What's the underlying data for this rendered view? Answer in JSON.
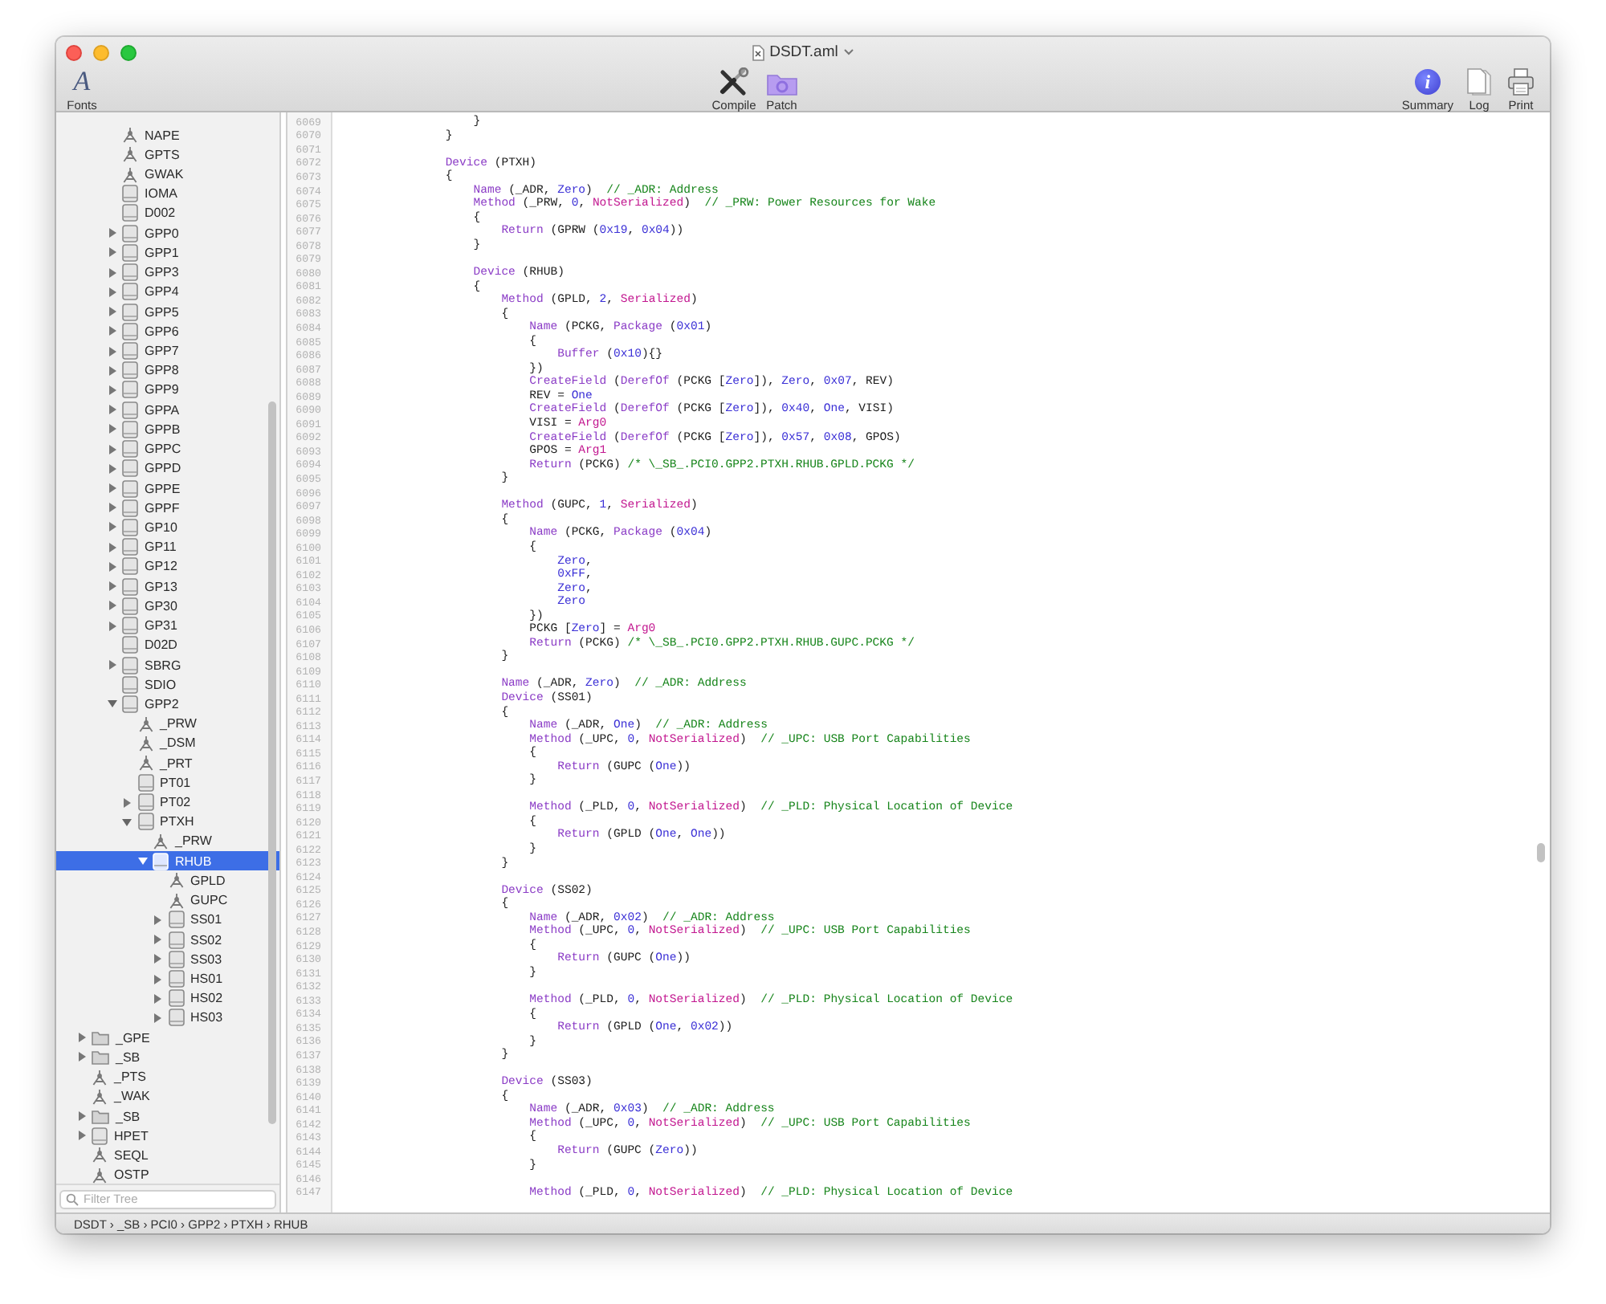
{
  "window": {
    "title": "DSDT.aml"
  },
  "toolbar": {
    "left": [
      {
        "kind": "fonts",
        "glyph": "A",
        "label": "Fonts"
      }
    ],
    "center": [
      {
        "kind": "compile",
        "label": "Compile"
      },
      {
        "kind": "patch",
        "label": "Patch"
      }
    ],
    "right": [
      {
        "kind": "summary",
        "glyph": "i",
        "label": "Summary"
      },
      {
        "kind": "log",
        "label": "Log"
      },
      {
        "kind": "print",
        "label": "Print"
      }
    ]
  },
  "sidebar": {
    "tree": [
      {
        "children": [
          {
            "children": [
              {
                "label": "NAPE",
                "kind": "method",
                "selected": false
              },
              {
                "label": "GPTS",
                "kind": "method",
                "selected": false
              },
              {
                "label": "GWAK",
                "kind": "method",
                "selected": false
              },
              {
                "label": "IOMA",
                "kind": "device",
                "selected": false
              },
              {
                "label": "D002",
                "kind": "device",
                "selected": false
              },
              {
                "label": "GPP0",
                "kind": "device",
                "expanded": false,
                "selected": false
              },
              {
                "label": "GPP1",
                "kind": "device",
                "expanded": false,
                "selected": false
              },
              {
                "label": "GPP3",
                "kind": "device",
                "expanded": false,
                "selected": false
              },
              {
                "label": "GPP4",
                "kind": "device",
                "expanded": false,
                "selected": false
              },
              {
                "label": "GPP5",
                "kind": "device",
                "expanded": false,
                "selected": false
              },
              {
                "label": "GPP6",
                "kind": "device",
                "expanded": false,
                "selected": false
              },
              {
                "label": "GPP7",
                "kind": "device",
                "expanded": false,
                "selected": false
              },
              {
                "label": "GPP8",
                "kind": "device",
                "expanded": false,
                "selected": false
              },
              {
                "label": "GPP9",
                "kind": "device",
                "expanded": false,
                "selected": false
              },
              {
                "label": "GPPA",
                "kind": "device",
                "expanded": false,
                "selected": false
              },
              {
                "label": "GPPB",
                "kind": "device",
                "expanded": false,
                "selected": false
              },
              {
                "label": "GPPC",
                "kind": "device",
                "expanded": false,
                "selected": false
              },
              {
                "label": "GPPD",
                "kind": "device",
                "expanded": false,
                "selected": false
              },
              {
                "label": "GPPE",
                "kind": "device",
                "expanded": false,
                "selected": false
              },
              {
                "label": "GPPF",
                "kind": "device",
                "expanded": false,
                "selected": false
              },
              {
                "label": "GP10",
                "kind": "device",
                "expanded": false,
                "selected": false
              },
              {
                "label": "GP11",
                "kind": "device",
                "expanded": false,
                "selected": false
              },
              {
                "label": "GP12",
                "kind": "device",
                "expanded": false,
                "selected": false
              },
              {
                "label": "GP13",
                "kind": "device",
                "expanded": false,
                "selected": false
              },
              {
                "label": "GP30",
                "kind": "device",
                "expanded": false,
                "selected": false
              },
              {
                "label": "GP31",
                "kind": "device",
                "expanded": false,
                "selected": false
              },
              {
                "label": "D02D",
                "kind": "device",
                "selected": false
              },
              {
                "label": "SBRG",
                "kind": "device",
                "expanded": false,
                "selected": false
              },
              {
                "label": "SDIO",
                "kind": "device",
                "selected": false
              },
              {
                "label": "GPP2",
                "kind": "device",
                "expanded": true,
                "selected": false,
                "children": [
                  {
                    "label": "_PRW",
                    "kind": "method",
                    "selected": false
                  },
                  {
                    "label": "_DSM",
                    "kind": "method",
                    "selected": false
                  },
                  {
                    "label": "_PRT",
                    "kind": "method",
                    "selected": false
                  },
                  {
                    "label": "PT01",
                    "kind": "device",
                    "selected": false
                  },
                  {
                    "label": "PT02",
                    "kind": "device",
                    "expanded": false,
                    "selected": false
                  },
                  {
                    "label": "PTXH",
                    "kind": "device",
                    "expanded": true,
                    "selected": false,
                    "children": [
                      {
                        "label": "_PRW",
                        "kind": "method",
                        "selected": false
                      },
                      {
                        "label": "RHUB",
                        "kind": "device",
                        "expanded": true,
                        "selected": true,
                        "children": [
                          {
                            "label": "GPLD",
                            "kind": "method",
                            "selected": false
                          },
                          {
                            "label": "GUPC",
                            "kind": "method",
                            "selected": false
                          },
                          {
                            "label": "SS01",
                            "kind": "device",
                            "expanded": false,
                            "selected": false
                          },
                          {
                            "label": "SS02",
                            "kind": "device",
                            "expanded": false,
                            "selected": false
                          },
                          {
                            "label": "SS03",
                            "kind": "device",
                            "expanded": false,
                            "selected": false
                          },
                          {
                            "label": "HS01",
                            "kind": "device",
                            "expanded": false,
                            "selected": false
                          },
                          {
                            "label": "HS02",
                            "kind": "device",
                            "expanded": false,
                            "selected": false
                          },
                          {
                            "label": "HS03",
                            "kind": "device",
                            "expanded": false,
                            "selected": false
                          }
                        ]
                      }
                    ]
                  }
                ]
              }
            ]
          }
        ]
      },
      {
        "label": "_GPE",
        "kind": "scope",
        "expanded": false,
        "selected": false
      },
      {
        "label": "_SB",
        "kind": "scope",
        "expanded": false,
        "selected": false
      },
      {
        "label": "_PTS",
        "kind": "method",
        "selected": false
      },
      {
        "label": "_WAK",
        "kind": "method",
        "selected": false
      },
      {
        "label": "_SB",
        "kind": "scope",
        "expanded": false,
        "selected": false
      },
      {
        "label": "HPET",
        "kind": "device",
        "expanded": false,
        "selected": false
      },
      {
        "label": "SEQL",
        "kind": "method",
        "selected": false
      },
      {
        "label": "OSTP",
        "kind": "method",
        "selected": false
      }
    ],
    "filter": {
      "placeholder": "Filter Tree"
    }
  },
  "code": {
    "lines": [
      {
        "number": "6069",
        "tokens": [
          {
            "kind": "plain",
            "text": "                }"
          }
        ]
      },
      {
        "number": "6070",
        "tokens": [
          {
            "kind": "plain",
            "text": "            }"
          }
        ]
      },
      {
        "number": "6071"
      },
      {
        "number": "6072",
        "tokens": [
          {
            "kind": "keyword",
            "text": "            Device"
          },
          {
            "kind": "plain",
            "text": " (PTXH)"
          }
        ]
      },
      {
        "number": "6073",
        "tokens": [
          {
            "kind": "plain",
            "text": "            {"
          }
        ]
      },
      {
        "number": "6074",
        "tokens": [
          {
            "kind": "keyword",
            "text": "                Name"
          },
          {
            "kind": "plain",
            "text": " (_ADR, "
          },
          {
            "kind": "number",
            "text": "Zero"
          },
          {
            "kind": "plain",
            "text": ")  "
          },
          {
            "kind": "comment",
            "text": "// _ADR: Address"
          }
        ]
      },
      {
        "number": "6075",
        "tokens": [
          {
            "kind": "keyword",
            "text": "                Method"
          },
          {
            "kind": "plain",
            "text": " (_PRW, "
          },
          {
            "kind": "number",
            "text": "0"
          },
          {
            "kind": "plain",
            "text": ", "
          },
          {
            "kind": "special",
            "text": "NotSerialized"
          },
          {
            "kind": "plain",
            "text": ")  "
          },
          {
            "kind": "comment",
            "text": "// _PRW: Power Resources for Wake"
          }
        ]
      },
      {
        "number": "6076",
        "tokens": [
          {
            "kind": "plain",
            "text": "                {"
          }
        ]
      },
      {
        "number": "6077",
        "tokens": [
          {
            "kind": "keyword",
            "text": "                    Return"
          },
          {
            "kind": "plain",
            "text": " (GPRW ("
          },
          {
            "kind": "number",
            "text": "0x19"
          },
          {
            "kind": "plain",
            "text": ", "
          },
          {
            "kind": "number",
            "text": "0x04"
          },
          {
            "kind": "plain",
            "text": "))"
          }
        ]
      },
      {
        "number": "6078",
        "tokens": [
          {
            "kind": "plain",
            "text": "                }"
          }
        ]
      },
      {
        "number": "6079"
      },
      {
        "number": "6080",
        "tokens": [
          {
            "kind": "keyword",
            "text": "                Device"
          },
          {
            "kind": "plain",
            "text": " (RHUB)"
          }
        ]
      },
      {
        "number": "6081",
        "tokens": [
          {
            "kind": "plain",
            "text": "                {"
          }
        ]
      },
      {
        "number": "6082",
        "tokens": [
          {
            "kind": "keyword",
            "text": "                    Method"
          },
          {
            "kind": "plain",
            "text": " (GPLD, "
          },
          {
            "kind": "number",
            "text": "2"
          },
          {
            "kind": "plain",
            "text": ", "
          },
          {
            "kind": "special",
            "text": "Serialized"
          },
          {
            "kind": "plain",
            "text": ")"
          }
        ]
      },
      {
        "number": "6083",
        "tokens": [
          {
            "kind": "plain",
            "text": "                    {"
          }
        ]
      },
      {
        "number": "6084",
        "tokens": [
          {
            "kind": "keyword",
            "text": "                        Name"
          },
          {
            "kind": "plain",
            "text": " (PCKG, "
          },
          {
            "kind": "keyword",
            "text": "Package"
          },
          {
            "kind": "plain",
            "text": " ("
          },
          {
            "kind": "number",
            "text": "0x01"
          },
          {
            "kind": "plain",
            "text": ")"
          }
        ]
      },
      {
        "number": "6085",
        "tokens": [
          {
            "kind": "plain",
            "text": "                        {"
          }
        ]
      },
      {
        "number": "6086",
        "tokens": [
          {
            "kind": "keyword",
            "text": "                            Buffer"
          },
          {
            "kind": "plain",
            "text": " ("
          },
          {
            "kind": "number",
            "text": "0x10"
          },
          {
            "kind": "plain",
            "text": "){}"
          }
        ]
      },
      {
        "number": "6087",
        "tokens": [
          {
            "kind": "plain",
            "text": "                        })"
          }
        ]
      },
      {
        "number": "6088",
        "tokens": [
          {
            "kind": "keyword",
            "text": "                        CreateField"
          },
          {
            "kind": "plain",
            "text": " ("
          },
          {
            "kind": "keyword",
            "text": "DerefOf"
          },
          {
            "kind": "plain",
            "text": " (PCKG ["
          },
          {
            "kind": "number",
            "text": "Zero"
          },
          {
            "kind": "plain",
            "text": "]), "
          },
          {
            "kind": "number",
            "text": "Zero"
          },
          {
            "kind": "plain",
            "text": ", "
          },
          {
            "kind": "number",
            "text": "0x07"
          },
          {
            "kind": "plain",
            "text": ", REV)"
          }
        ]
      },
      {
        "number": "6089",
        "tokens": [
          {
            "kind": "plain",
            "text": "                        REV = "
          },
          {
            "kind": "number",
            "text": "One"
          }
        ]
      },
      {
        "number": "6090",
        "tokens": [
          {
            "kind": "keyword",
            "text": "                        CreateField"
          },
          {
            "kind": "plain",
            "text": " ("
          },
          {
            "kind": "keyword",
            "text": "DerefOf"
          },
          {
            "kind": "plain",
            "text": " (PCKG ["
          },
          {
            "kind": "number",
            "text": "Zero"
          },
          {
            "kind": "plain",
            "text": "]), "
          },
          {
            "kind": "number",
            "text": "0x40"
          },
          {
            "kind": "plain",
            "text": ", "
          },
          {
            "kind": "number",
            "text": "One"
          },
          {
            "kind": "plain",
            "text": ", VISI)"
          }
        ]
      },
      {
        "number": "6091",
        "tokens": [
          {
            "kind": "plain",
            "text": "                        VISI = "
          },
          {
            "kind": "special",
            "text": "Arg0"
          }
        ]
      },
      {
        "number": "6092",
        "tokens": [
          {
            "kind": "keyword",
            "text": "                        CreateField"
          },
          {
            "kind": "plain",
            "text": " ("
          },
          {
            "kind": "keyword",
            "text": "DerefOf"
          },
          {
            "kind": "plain",
            "text": " (PCKG ["
          },
          {
            "kind": "number",
            "text": "Zero"
          },
          {
            "kind": "plain",
            "text": "]), "
          },
          {
            "kind": "number",
            "text": "0x57"
          },
          {
            "kind": "plain",
            "text": ", "
          },
          {
            "kind": "number",
            "text": "0x08"
          },
          {
            "kind": "plain",
            "text": ", GPOS)"
          }
        ]
      },
      {
        "number": "6093",
        "tokens": [
          {
            "kind": "plain",
            "text": "                        GPOS = "
          },
          {
            "kind": "special",
            "text": "Arg1"
          }
        ]
      },
      {
        "number": "6094",
        "tokens": [
          {
            "kind": "keyword",
            "text": "                        Return"
          },
          {
            "kind": "plain",
            "text": " (PCKG) "
          },
          {
            "kind": "comment",
            "text": "/* \\_SB_.PCI0.GPP2.PTXH.RHUB.GPLD.PCKG */"
          }
        ]
      },
      {
        "number": "6095",
        "tokens": [
          {
            "kind": "plain",
            "text": "                    }"
          }
        ]
      },
      {
        "number": "6096"
      },
      {
        "number": "6097",
        "tokens": [
          {
            "kind": "keyword",
            "text": "                    Method"
          },
          {
            "kind": "plain",
            "text": " (GUPC, "
          },
          {
            "kind": "number",
            "text": "1"
          },
          {
            "kind": "plain",
            "text": ", "
          },
          {
            "kind": "special",
            "text": "Serialized"
          },
          {
            "kind": "plain",
            "text": ")"
          }
        ]
      },
      {
        "number": "6098",
        "tokens": [
          {
            "kind": "plain",
            "text": "                    {"
          }
        ]
      },
      {
        "number": "6099",
        "tokens": [
          {
            "kind": "keyword",
            "text": "                        Name"
          },
          {
            "kind": "plain",
            "text": " (PCKG, "
          },
          {
            "kind": "keyword",
            "text": "Package"
          },
          {
            "kind": "plain",
            "text": " ("
          },
          {
            "kind": "number",
            "text": "0x04"
          },
          {
            "kind": "plain",
            "text": ")"
          }
        ]
      },
      {
        "number": "6100",
        "tokens": [
          {
            "kind": "plain",
            "text": "                        {"
          }
        ]
      },
      {
        "number": "6101",
        "tokens": [
          {
            "kind": "number",
            "text": "                            Zero"
          },
          {
            "kind": "plain",
            "text": ","
          }
        ]
      },
      {
        "number": "6102",
        "tokens": [
          {
            "kind": "number",
            "text": "                            0xFF"
          },
          {
            "kind": "plain",
            "text": ","
          }
        ]
      },
      {
        "number": "6103",
        "tokens": [
          {
            "kind": "number",
            "text": "                            Zero"
          },
          {
            "kind": "plain",
            "text": ","
          }
        ]
      },
      {
        "number": "6104",
        "tokens": [
          {
            "kind": "number",
            "text": "                            Zero"
          }
        ]
      },
      {
        "number": "6105",
        "tokens": [
          {
            "kind": "plain",
            "text": "                        })"
          }
        ]
      },
      {
        "number": "6106",
        "tokens": [
          {
            "kind": "plain",
            "text": "                        PCKG ["
          },
          {
            "kind": "number",
            "text": "Zero"
          },
          {
            "kind": "plain",
            "text": "] = "
          },
          {
            "kind": "special",
            "text": "Arg0"
          }
        ]
      },
      {
        "number": "6107",
        "tokens": [
          {
            "kind": "keyword",
            "text": "                        Return"
          },
          {
            "kind": "plain",
            "text": " (PCKG) "
          },
          {
            "kind": "comment",
            "text": "/* \\_SB_.PCI0.GPP2.PTXH.RHUB.GUPC.PCKG */"
          }
        ]
      },
      {
        "number": "6108",
        "tokens": [
          {
            "kind": "plain",
            "text": "                    }"
          }
        ]
      },
      {
        "number": "6109"
      },
      {
        "number": "6110",
        "tokens": [
          {
            "kind": "keyword",
            "text": "                    Name"
          },
          {
            "kind": "plain",
            "text": " (_ADR, "
          },
          {
            "kind": "number",
            "text": "Zero"
          },
          {
            "kind": "plain",
            "text": ")  "
          },
          {
            "kind": "comment",
            "text": "// _ADR: Address"
          }
        ]
      },
      {
        "number": "6111",
        "tokens": [
          {
            "kind": "keyword",
            "text": "                    Device"
          },
          {
            "kind": "plain",
            "text": " (SS01)"
          }
        ]
      },
      {
        "number": "6112",
        "tokens": [
          {
            "kind": "plain",
            "text": "                    {"
          }
        ]
      },
      {
        "number": "6113",
        "tokens": [
          {
            "kind": "keyword",
            "text": "                        Name"
          },
          {
            "kind": "plain",
            "text": " (_ADR, "
          },
          {
            "kind": "number",
            "text": "One"
          },
          {
            "kind": "plain",
            "text": ")  "
          },
          {
            "kind": "comment",
            "text": "// _ADR: Address"
          }
        ]
      },
      {
        "number": "6114",
        "tokens": [
          {
            "kind": "keyword",
            "text": "                        Method"
          },
          {
            "kind": "plain",
            "text": " (_UPC, "
          },
          {
            "kind": "number",
            "text": "0"
          },
          {
            "kind": "plain",
            "text": ", "
          },
          {
            "kind": "special",
            "text": "NotSerialized"
          },
          {
            "kind": "plain",
            "text": ")  "
          },
          {
            "kind": "comment",
            "text": "// _UPC: USB Port Capabilities"
          }
        ]
      },
      {
        "number": "6115",
        "tokens": [
          {
            "kind": "plain",
            "text": "                        {"
          }
        ]
      },
      {
        "number": "6116",
        "tokens": [
          {
            "kind": "keyword",
            "text": "                            Return"
          },
          {
            "kind": "plain",
            "text": " (GUPC ("
          },
          {
            "kind": "number",
            "text": "One"
          },
          {
            "kind": "plain",
            "text": "))"
          }
        ]
      },
      {
        "number": "6117",
        "tokens": [
          {
            "kind": "plain",
            "text": "                        }"
          }
        ]
      },
      {
        "number": "6118"
      },
      {
        "number": "6119",
        "tokens": [
          {
            "kind": "keyword",
            "text": "                        Method"
          },
          {
            "kind": "plain",
            "text": " (_PLD, "
          },
          {
            "kind": "number",
            "text": "0"
          },
          {
            "kind": "plain",
            "text": ", "
          },
          {
            "kind": "special",
            "text": "NotSerialized"
          },
          {
            "kind": "plain",
            "text": ")  "
          },
          {
            "kind": "comment",
            "text": "// _PLD: Physical Location of Device"
          }
        ]
      },
      {
        "number": "6120",
        "tokens": [
          {
            "kind": "plain",
            "text": "                        {"
          }
        ]
      },
      {
        "number": "6121",
        "tokens": [
          {
            "kind": "keyword",
            "text": "                            Return"
          },
          {
            "kind": "plain",
            "text": " (GPLD ("
          },
          {
            "kind": "number",
            "text": "One"
          },
          {
            "kind": "plain",
            "text": ", "
          },
          {
            "kind": "number",
            "text": "One"
          },
          {
            "kind": "plain",
            "text": "))"
          }
        ]
      },
      {
        "number": "6122",
        "tokens": [
          {
            "kind": "plain",
            "text": "                        }"
          }
        ]
      },
      {
        "number": "6123",
        "tokens": [
          {
            "kind": "plain",
            "text": "                    }"
          }
        ]
      },
      {
        "number": "6124"
      },
      {
        "number": "6125",
        "tokens": [
          {
            "kind": "keyword",
            "text": "                    Device"
          },
          {
            "kind": "plain",
            "text": " (SS02)"
          }
        ]
      },
      {
        "number": "6126",
        "tokens": [
          {
            "kind": "plain",
            "text": "                    {"
          }
        ]
      },
      {
        "number": "6127",
        "tokens": [
          {
            "kind": "keyword",
            "text": "                        Name"
          },
          {
            "kind": "plain",
            "text": " (_ADR, "
          },
          {
            "kind": "number",
            "text": "0x02"
          },
          {
            "kind": "plain",
            "text": ")  "
          },
          {
            "kind": "comment",
            "text": "// _ADR: Address"
          }
        ]
      },
      {
        "number": "6128",
        "tokens": [
          {
            "kind": "keyword",
            "text": "                        Method"
          },
          {
            "kind": "plain",
            "text": " (_UPC, "
          },
          {
            "kind": "number",
            "text": "0"
          },
          {
            "kind": "plain",
            "text": ", "
          },
          {
            "kind": "special",
            "text": "NotSerialized"
          },
          {
            "kind": "plain",
            "text": ")  "
          },
          {
            "kind": "comment",
            "text": "// _UPC: USB Port Capabilities"
          }
        ]
      },
      {
        "number": "6129",
        "tokens": [
          {
            "kind": "plain",
            "text": "                        {"
          }
        ]
      },
      {
        "number": "6130",
        "tokens": [
          {
            "kind": "keyword",
            "text": "                            Return"
          },
          {
            "kind": "plain",
            "text": " (GUPC ("
          },
          {
            "kind": "number",
            "text": "One"
          },
          {
            "kind": "plain",
            "text": "))"
          }
        ]
      },
      {
        "number": "6131",
        "tokens": [
          {
            "kind": "plain",
            "text": "                        }"
          }
        ]
      },
      {
        "number": "6132"
      },
      {
        "number": "6133",
        "tokens": [
          {
            "kind": "keyword",
            "text": "                        Method"
          },
          {
            "kind": "plain",
            "text": " (_PLD, "
          },
          {
            "kind": "number",
            "text": "0"
          },
          {
            "kind": "plain",
            "text": ", "
          },
          {
            "kind": "special",
            "text": "NotSerialized"
          },
          {
            "kind": "plain",
            "text": ")  "
          },
          {
            "kind": "comment",
            "text": "// _PLD: Physical Location of Device"
          }
        ]
      },
      {
        "number": "6134",
        "tokens": [
          {
            "kind": "plain",
            "text": "                        {"
          }
        ]
      },
      {
        "number": "6135",
        "tokens": [
          {
            "kind": "keyword",
            "text": "                            Return"
          },
          {
            "kind": "plain",
            "text": " (GPLD ("
          },
          {
            "kind": "number",
            "text": "One"
          },
          {
            "kind": "plain",
            "text": ", "
          },
          {
            "kind": "number",
            "text": "0x02"
          },
          {
            "kind": "plain",
            "text": "))"
          }
        ]
      },
      {
        "number": "6136",
        "tokens": [
          {
            "kind": "plain",
            "text": "                        }"
          }
        ]
      },
      {
        "number": "6137",
        "tokens": [
          {
            "kind": "plain",
            "text": "                    }"
          }
        ]
      },
      {
        "number": "6138"
      },
      {
        "number": "6139",
        "tokens": [
          {
            "kind": "keyword",
            "text": "                    Device"
          },
          {
            "kind": "plain",
            "text": " (SS03)"
          }
        ]
      },
      {
        "number": "6140",
        "tokens": [
          {
            "kind": "plain",
            "text": "                    {"
          }
        ]
      },
      {
        "number": "6141",
        "tokens": [
          {
            "kind": "keyword",
            "text": "                        Name"
          },
          {
            "kind": "plain",
            "text": " (_ADR, "
          },
          {
            "kind": "number",
            "text": "0x03"
          },
          {
            "kind": "plain",
            "text": ")  "
          },
          {
            "kind": "comment",
            "text": "// _ADR: Address"
          }
        ]
      },
      {
        "number": "6142",
        "tokens": [
          {
            "kind": "keyword",
            "text": "                        Method"
          },
          {
            "kind": "plain",
            "text": " (_UPC, "
          },
          {
            "kind": "number",
            "text": "0"
          },
          {
            "kind": "plain",
            "text": ", "
          },
          {
            "kind": "special",
            "text": "NotSerialized"
          },
          {
            "kind": "plain",
            "text": ")  "
          },
          {
            "kind": "comment",
            "text": "// _UPC: USB Port Capabilities"
          }
        ]
      },
      {
        "number": "6143",
        "tokens": [
          {
            "kind": "plain",
            "text": "                        {"
          }
        ]
      },
      {
        "number": "6144",
        "tokens": [
          {
            "kind": "keyword",
            "text": "                            Return"
          },
          {
            "kind": "plain",
            "text": " (GUPC ("
          },
          {
            "kind": "number",
            "text": "Zero"
          },
          {
            "kind": "plain",
            "text": "))"
          }
        ]
      },
      {
        "number": "6145",
        "tokens": [
          {
            "kind": "plain",
            "text": "                        }"
          }
        ]
      },
      {
        "number": "6146"
      },
      {
        "number": "6147",
        "tokens": [
          {
            "kind": "keyword",
            "text": "                        Method"
          },
          {
            "kind": "plain",
            "text": " (_PLD, "
          },
          {
            "kind": "number",
            "text": "0"
          },
          {
            "kind": "plain",
            "text": ", "
          },
          {
            "kind": "special",
            "text": "NotSerialized"
          },
          {
            "kind": "plain",
            "text": ")  "
          },
          {
            "kind": "comment",
            "text": "// _PLD: Physical Location of Device"
          }
        ]
      }
    ]
  },
  "status_bar": {
    "path": "DSDT › _SB › PCI0 › GPP2 › PTXH › RHUB"
  }
}
